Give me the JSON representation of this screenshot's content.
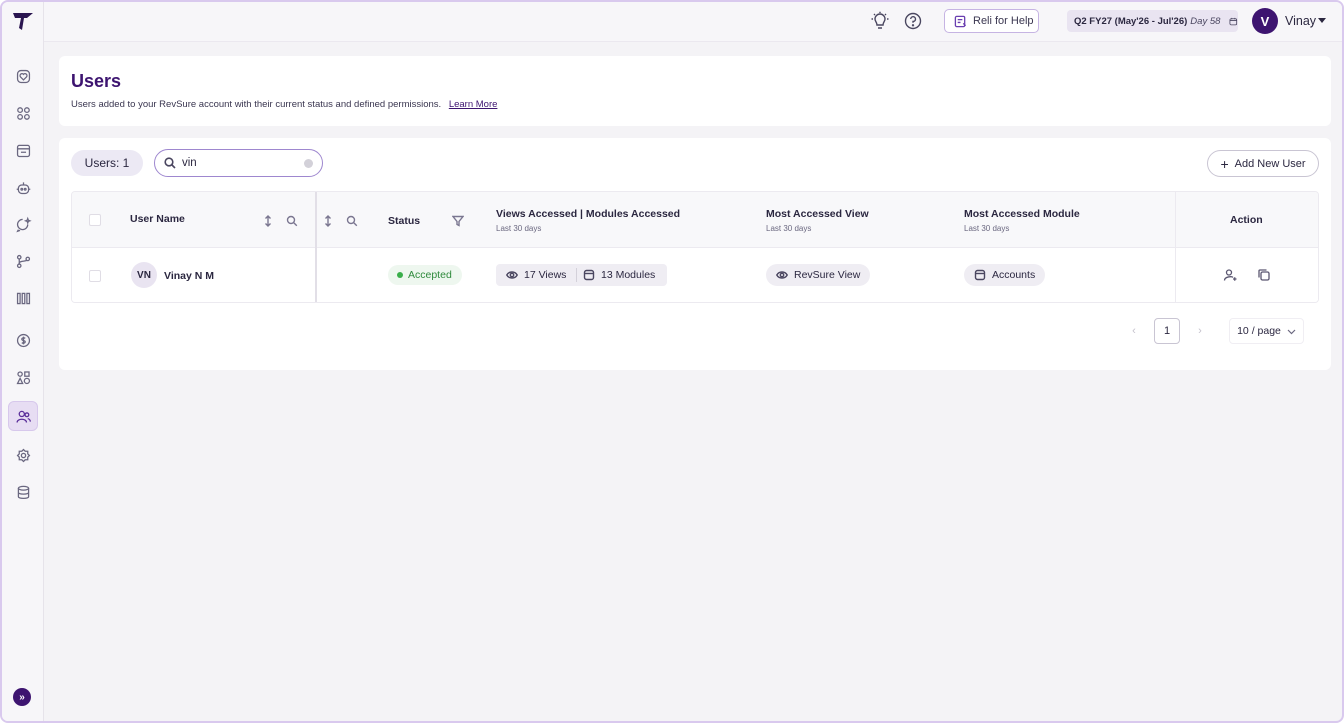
{
  "sidebar": {
    "icons": [
      "heart-icon",
      "grid-icon",
      "calendar-icon",
      "bot-icon",
      "chat-spark-icon",
      "branch-icon",
      "columns-icon",
      "dollar-icon",
      "shapes-icon",
      "users-icon",
      "settings-icon",
      "database-icon"
    ],
    "active": "users-icon",
    "expand_label": "»"
  },
  "topbar": {
    "reli_label": "Reli for Help",
    "period_quarter": "Q2 FY27 (May'26 - Jul'26)",
    "period_day": "Day 58",
    "avatar_initial": "V",
    "user_name": "Vinay"
  },
  "header": {
    "title": "Users",
    "subtitle": "Users added to your RevSure account with their current status and defined permissions.",
    "learn_more": "Learn More"
  },
  "toolbar": {
    "users_count": "Users: 1",
    "search_value": "vin",
    "add_user_label": "Add New User"
  },
  "table": {
    "columns": {
      "user_name": "User Name",
      "status": "Status",
      "views_modules": "Views Accessed | Modules Accessed",
      "views_modules_sub": "Last 30 days",
      "most_view": "Most Accessed View",
      "most_view_sub": "Last 30 days",
      "most_module": "Most Accessed Module",
      "most_module_sub": "Last 30 days",
      "action": "Action"
    },
    "rows": [
      {
        "initials": "VN",
        "name": "Vinay N M",
        "status": "Accepted",
        "views": "17 Views",
        "modules": "13 Modules",
        "most_view": "RevSure View",
        "most_module": "Accounts"
      }
    ]
  },
  "pagination": {
    "current_page": "1",
    "page_size": "10 / page",
    "prev": "‹",
    "next": "›"
  },
  "colors": {
    "brand": "#3d1470",
    "status_accepted": "#2f8a3c",
    "active_nav_bg": "#e7ddf3"
  }
}
